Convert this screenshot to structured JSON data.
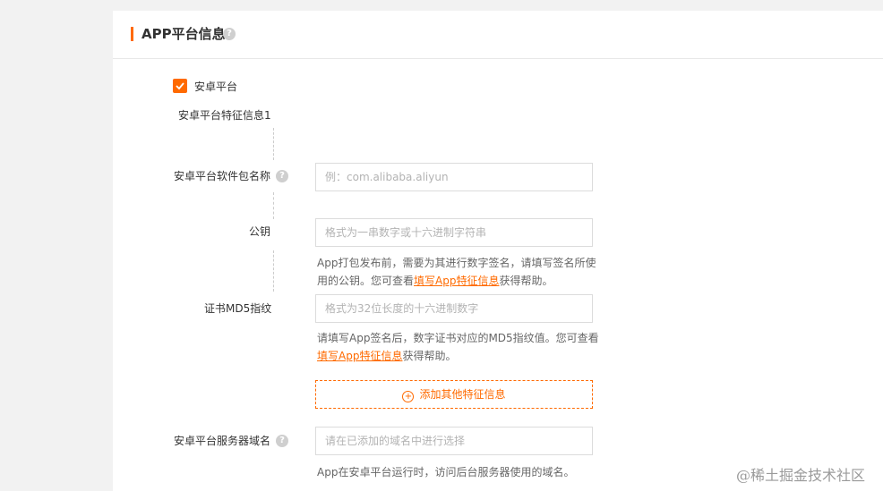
{
  "section": {
    "title": "APP平台信息",
    "help_glyph": "?"
  },
  "android": {
    "checkbox_label": "安卓平台",
    "checked": true,
    "group_label": "安卓平台特征信息1",
    "package_name": {
      "label": "安卓平台软件包名称",
      "placeholder": "例：com.alibaba.aliyun",
      "value": ""
    },
    "public_key": {
      "label": "公钥",
      "placeholder": "格式为一串数字或十六进制字符串",
      "value": "",
      "hint_before": "App打包发布前，需要为其进行数字签名，请填写签名所使用的公钥。您可查看",
      "hint_link": "填写App特征信息",
      "hint_after": "获得帮助。"
    },
    "md5": {
      "label": "证书MD5指纹",
      "placeholder": "格式为32位长度的十六进制数字",
      "value": "",
      "hint_before": "请填写App签名后，数字证书对应的MD5指纹值。您可查看",
      "hint_link": "填写App特征信息",
      "hint_after": "获得帮助。"
    },
    "add_button": {
      "icon_glyph": "+",
      "label": "添加其他特征信息"
    },
    "server_domain": {
      "label": "安卓平台服务器域名",
      "placeholder": "请在已添加的域名中进行选择",
      "value": "",
      "hint": "App在安卓平台运行时，访问后台服务器使用的域名。"
    }
  },
  "watermark": "@稀土掘金技术社区",
  "colors": {
    "accent": "#ff6a00",
    "border": "#dcdcdc",
    "background": "#f2f2f2"
  }
}
